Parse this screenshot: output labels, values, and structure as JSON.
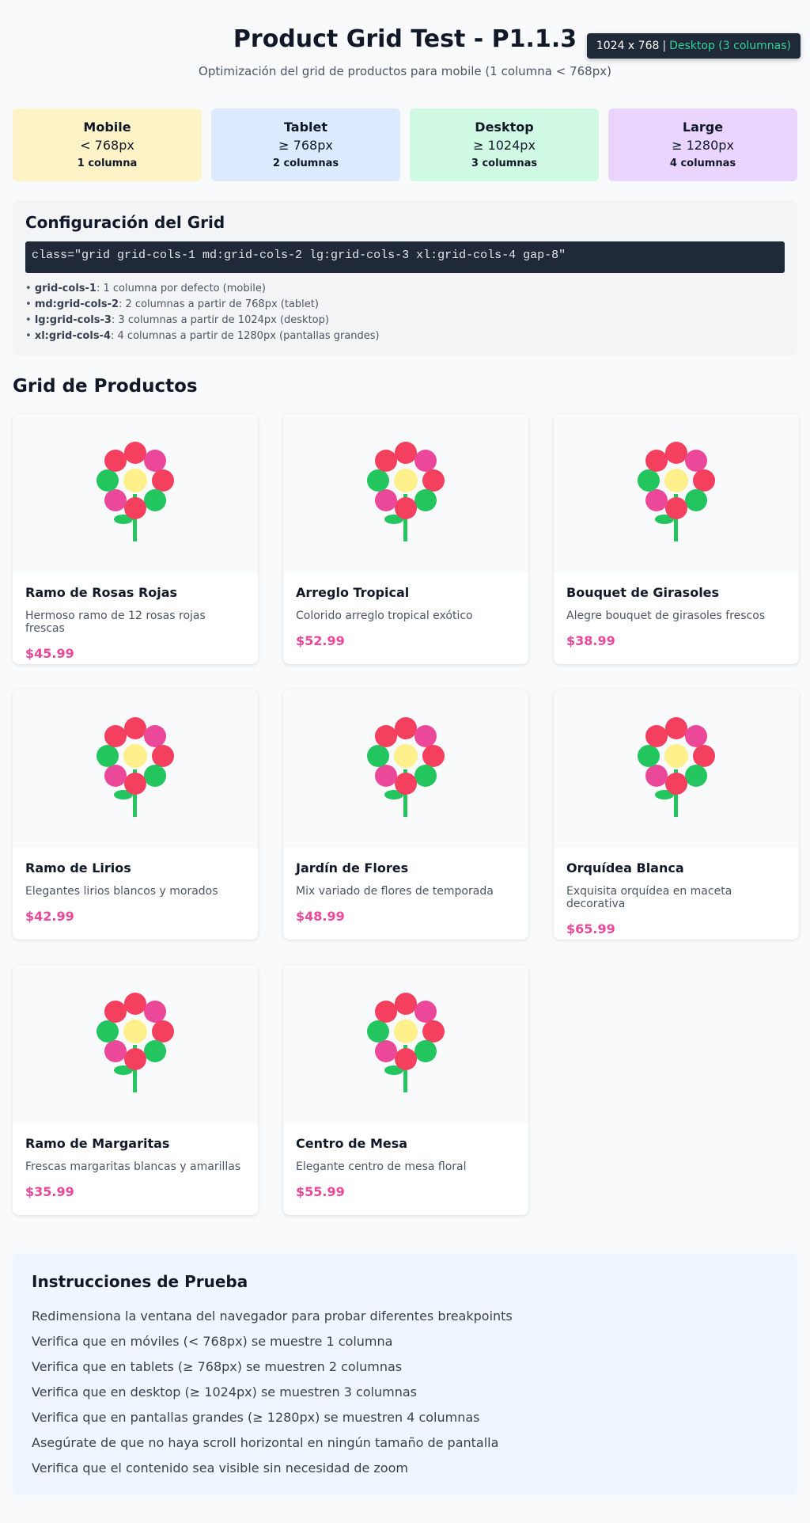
{
  "viewport": {
    "size": "1024 x 768",
    "separator": "|",
    "mode": "Desktop (3 columnas)"
  },
  "header": {
    "title": "Product Grid Test - P1.1.3",
    "subtitle": "Optimización del grid de productos para mobile (1 columna < 768px)"
  },
  "breakpoints": [
    {
      "name": "Mobile",
      "range": "< 768px",
      "columns": "1 columna",
      "color": "#fef3c7"
    },
    {
      "name": "Tablet",
      "range": "≥ 768px",
      "columns": "2 columnas",
      "color": "#dbeafe"
    },
    {
      "name": "Desktop",
      "range": "≥ 1024px",
      "columns": "3 columnas",
      "color": "#d1fae5"
    },
    {
      "name": "Large",
      "range": "≥ 1280px",
      "columns": "4 columnas",
      "color": "#e9d5ff"
    }
  ],
  "config": {
    "title": "Configuración del Grid",
    "code": "class=\"grid grid-cols-1 md:grid-cols-2 lg:grid-cols-3 xl:grid-cols-4 gap-8\"",
    "notes": [
      {
        "key": "grid-cols-1",
        "text": ": 1 columna por defecto (mobile)"
      },
      {
        "key": "md:grid-cols-2",
        "text": ": 2 columnas a partir de 768px (tablet)"
      },
      {
        "key": "lg:grid-cols-3",
        "text": ": 3 columnas a partir de 1024px (desktop)"
      },
      {
        "key": "xl:grid-cols-4",
        "text": ": 4 columnas a partir de 1280px (pantallas grandes)"
      }
    ]
  },
  "grid": {
    "title": "Grid de Productos",
    "price_color": "#ec4899",
    "products": [
      {
        "name": "Ramo de Rosas Rojas",
        "description": "Hermoso ramo de 12 rosas rojas frescas",
        "price": "$45.99",
        "icon": "flower-icon"
      },
      {
        "name": "Arreglo Tropical",
        "description": "Colorido arreglo tropical exótico",
        "price": "$52.99",
        "icon": "flower-icon"
      },
      {
        "name": "Bouquet de Girasoles",
        "description": "Alegre bouquet de girasoles frescos",
        "price": "$38.99",
        "icon": "flower-icon"
      },
      {
        "name": "Ramo de Lirios",
        "description": "Elegantes lirios blancos y morados",
        "price": "$42.99",
        "icon": "flower-icon"
      },
      {
        "name": "Jardín de Flores",
        "description": "Mix variado de flores de temporada",
        "price": "$48.99",
        "icon": "flower-icon"
      },
      {
        "name": "Orquídea Blanca",
        "description": "Exquisita orquídea en maceta decorativa",
        "price": "$65.99",
        "icon": "flower-icon"
      },
      {
        "name": "Ramo de Margaritas",
        "description": "Frescas margaritas blancas y amarillas",
        "price": "$35.99",
        "icon": "flower-icon"
      },
      {
        "name": "Centro de Mesa",
        "description": "Elegante centro de mesa floral",
        "price": "$55.99",
        "icon": "flower-icon"
      }
    ]
  },
  "instructions": {
    "title": "Instrucciones de Prueba",
    "items": [
      "Redimensiona la ventana del navegador para probar diferentes breakpoints",
      "Verifica que en móviles (< 768px) se muestre 1 columna",
      "Verifica que en tablets (≥ 768px) se muestren 2 columnas",
      "Verifica que en desktop (≥ 1024px) se muestren 3 columnas",
      "Verifica que en pantallas grandes (≥ 1280px) se muestren 4 columnas",
      "Asegúrate de que no haya scroll horizontal en ningún tamaño de pantalla",
      "Verifica que el contenido sea visible sin necesidad de zoom"
    ]
  }
}
